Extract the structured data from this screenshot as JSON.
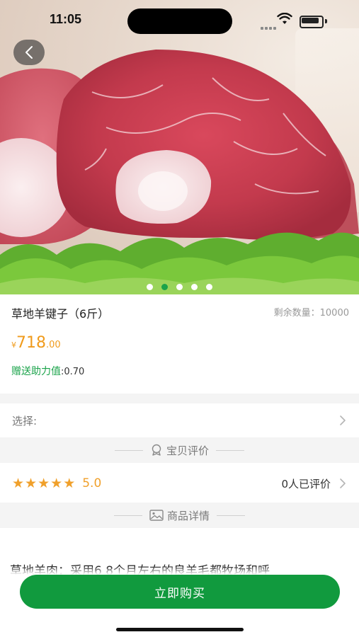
{
  "status_bar": {
    "time": "11:05"
  },
  "icons": {
    "back": "back-chevron-icon",
    "wifi": "wifi-icon",
    "battery": "battery-icon",
    "review_section": "review-badge-icon",
    "detail_section": "image-icon",
    "chevron": "chevron-right-icon"
  },
  "product": {
    "title": "草地羊键子（6斤）",
    "stock_label": "剩余数量：",
    "stock_value": "10000",
    "currency": "¥",
    "price_int": "718",
    "price_dec": ".00",
    "bonus_label": "赠送助力值",
    "bonus_value": ":0.70"
  },
  "select": {
    "label": "选择:"
  },
  "reviews_section": {
    "title": "宝贝评价"
  },
  "rating": {
    "score": "5.0",
    "stars": 5,
    "count_text": "0人已评价"
  },
  "detail_section": {
    "title": "商品详情"
  },
  "description": {
    "text": "草地羊肉：采用6 8个月左右的良羊毛都牧场和呼"
  },
  "action": {
    "buy_label": "立即购买"
  },
  "carousel": {
    "total": 5,
    "active_index": 1
  },
  "colors": {
    "primary": "#119a3e",
    "price": "#f09b1c",
    "star": "#f0a02b",
    "bonus": "#1aa34a"
  }
}
